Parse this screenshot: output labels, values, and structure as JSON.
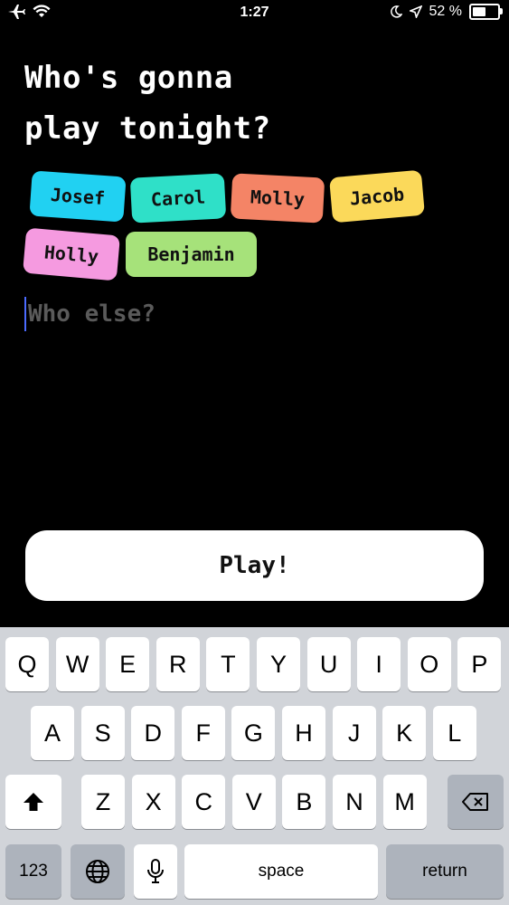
{
  "status_bar": {
    "time": "1:27",
    "battery_percent": "52 %",
    "battery_level": 0.52,
    "left_icons": [
      "airplane-icon",
      "wifi-icon"
    ],
    "right_icons": [
      "moon-icon",
      "location-icon",
      "battery-icon"
    ]
  },
  "title": "Who's gonna\nplay tonight?",
  "players": [
    {
      "name": "Josef",
      "color": "#21d1f2"
    },
    {
      "name": "Carol",
      "color": "#2fe0c8"
    },
    {
      "name": "Molly",
      "color": "#f48466"
    },
    {
      "name": "Jacob",
      "color": "#fbd95a"
    },
    {
      "name": "Holly",
      "color": "#f59ae0"
    },
    {
      "name": "Benjamin",
      "color": "#a6e27a"
    }
  ],
  "input": {
    "placeholder": "Who else?"
  },
  "play_label": "Play!",
  "keyboard": {
    "row1": [
      "Q",
      "W",
      "E",
      "R",
      "T",
      "Y",
      "U",
      "I",
      "O",
      "P"
    ],
    "row2": [
      "A",
      "S",
      "D",
      "F",
      "G",
      "H",
      "J",
      "K",
      "L"
    ],
    "row3": [
      "Z",
      "X",
      "C",
      "V",
      "B",
      "N",
      "M"
    ],
    "numbers_label": "123",
    "space_label": "space",
    "return_label": "return",
    "icons": [
      "shift-icon",
      "delete-icon",
      "globe-icon",
      "microphone-icon"
    ]
  }
}
